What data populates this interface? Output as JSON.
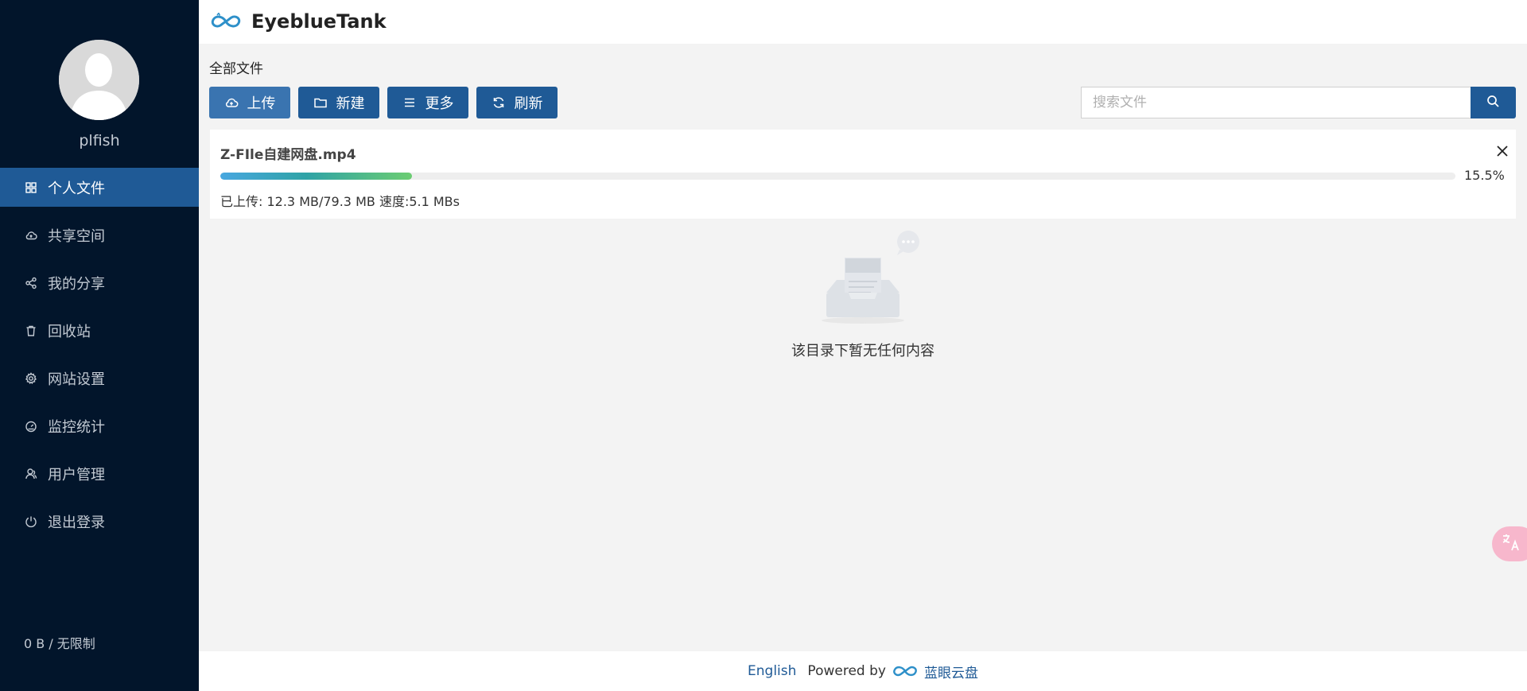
{
  "sidebar": {
    "username": "plfish",
    "items": [
      {
        "label": "个人文件",
        "icon": "grid-icon",
        "active": true
      },
      {
        "label": "共享空间",
        "icon": "cloud-icon",
        "active": false
      },
      {
        "label": "我的分享",
        "icon": "share-icon",
        "active": false
      },
      {
        "label": "回收站",
        "icon": "trash-icon",
        "active": false
      },
      {
        "label": "网站设置",
        "icon": "gear-icon",
        "active": false
      },
      {
        "label": "监控统计",
        "icon": "dashboard-icon",
        "active": false
      },
      {
        "label": "用户管理",
        "icon": "user-icon",
        "active": false
      },
      {
        "label": "退出登录",
        "icon": "power-icon",
        "active": false
      }
    ],
    "quota": "0 B / 无限制"
  },
  "header": {
    "app_name": "EyeblueTank"
  },
  "breadcrumb": "全部文件",
  "toolbar": {
    "upload_label": "上传",
    "new_label": "新建",
    "more_label": "更多",
    "refresh_label": "刷新"
  },
  "search": {
    "placeholder": "搜索文件"
  },
  "upload": {
    "file_name": "Z-FIle自建网盘.mp4",
    "progress_percent": 15.5,
    "progress_text": "15.5%",
    "info_text": "已上传: 12.3 MB/79.3 MB 速度:5.1 MBs"
  },
  "empty_state": {
    "message": "该目录下暂无任何内容"
  },
  "footer": {
    "language": "English",
    "powered_by": "Powered by",
    "brand_name": "蓝眼云盘"
  },
  "colors": {
    "sidebar_bg": "#02152b",
    "accent": "#1f5a96",
    "active_item": "#1f5a96",
    "page_bg": "#f3f3f3"
  }
}
